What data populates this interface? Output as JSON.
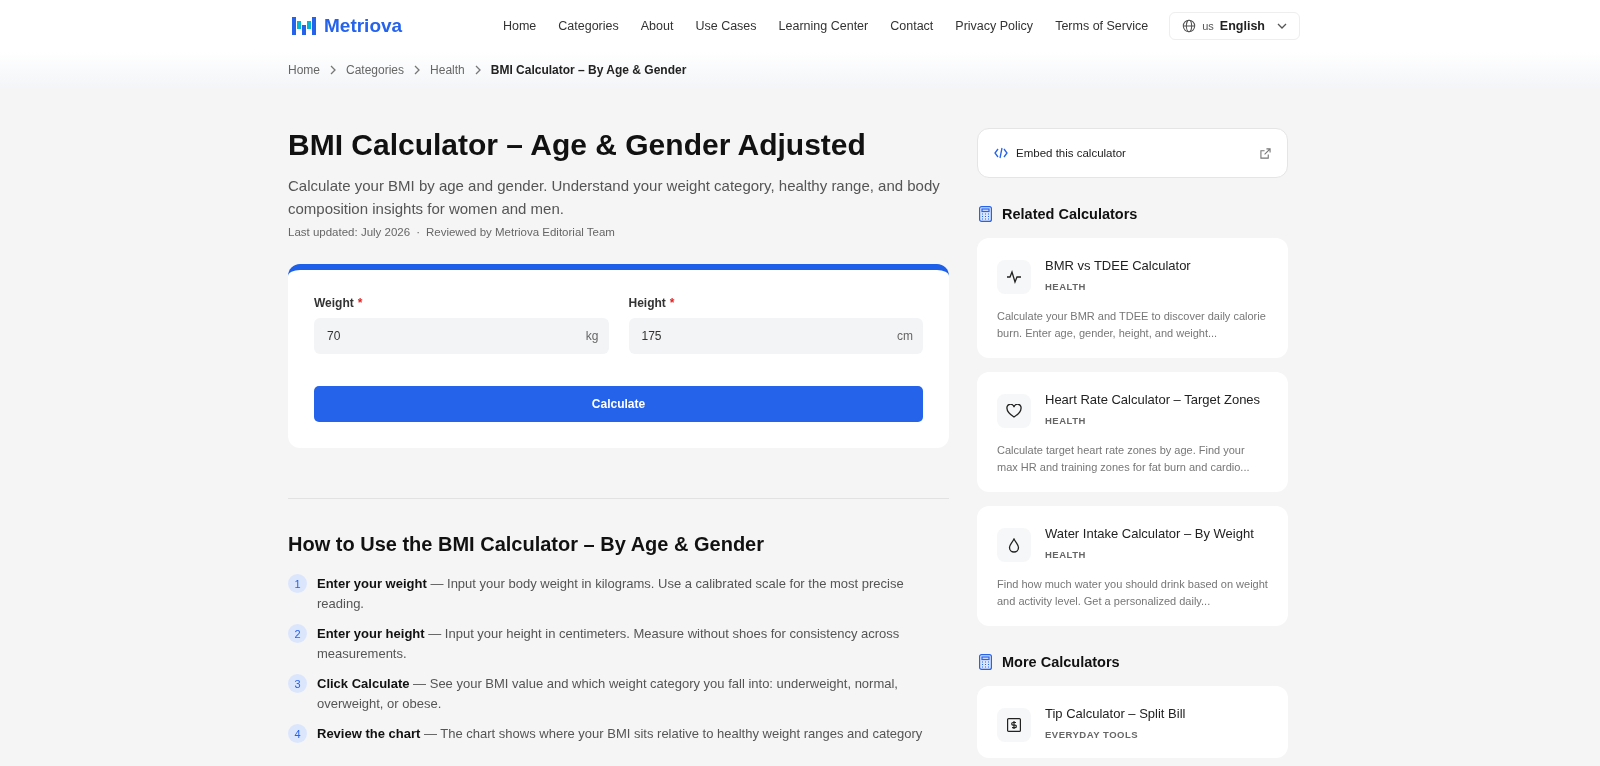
{
  "header": {
    "logo": "Metriova",
    "nav": [
      "Home",
      "Categories",
      "About",
      "Use Cases",
      "Learning Center",
      "Contact",
      "Privacy Policy",
      "Terms of Service"
    ],
    "language": {
      "code": "us",
      "label": "English"
    }
  },
  "breadcrumb": [
    "Home",
    "Categories",
    "Health",
    "BMI Calculator – By Age & Gender"
  ],
  "page": {
    "title": "BMI Calculator – Age & Gender Adjusted",
    "intro": "Calculate your BMI by age and gender. Understand your weight category, healthy range, and body composition insights for women and men.",
    "updated": "Last updated: July 2026",
    "separator": "·",
    "reviewed": "Reviewed by Metriova Editorial Team"
  },
  "form": {
    "fields": [
      {
        "label": "Weight",
        "required_mark": "*",
        "value": "70",
        "unit": "kg"
      },
      {
        "label": "Height",
        "required_mark": "*",
        "value": "175",
        "unit": "cm"
      }
    ],
    "button": "Calculate"
  },
  "how_to": {
    "title": "How to Use the BMI Calculator – By Age & Gender",
    "steps": [
      {
        "number": "1",
        "text": "**Enter your weight** — Input your body weight in kilograms. Use a calibrated scale for the most precise reading."
      },
      {
        "number": "2",
        "text": "**Enter your height** — Input your height in centimeters. Measure without shoes for consistency across measurements."
      },
      {
        "number": "3",
        "text": "**Click Calculate** — See your BMI value and which weight category you fall into: underweight, normal, overweight, or obese."
      },
      {
        "number": "4",
        "text": "**Review the chart** — The chart shows where your BMI sits relative to healthy weight ranges and category"
      }
    ]
  },
  "sidebar": {
    "embed": "Embed this calculator",
    "related": {
      "title": "Related Calculators",
      "items": [
        {
          "kind": "pulse",
          "title": "BMR vs TDEE Calculator",
          "category": "HEALTH",
          "description": "Calculate your BMR and TDEE to discover daily calorie burn. Enter age, gender, height, and weight..."
        },
        {
          "kind": "heart",
          "title": "Heart Rate Calculator – Target Zones",
          "category": "HEALTH",
          "description": "Calculate target heart rate zones by age. Find your max HR and training zones for fat burn and cardio..."
        },
        {
          "kind": "drop",
          "title": "Water Intake Calculator – By Weight",
          "category": "HEALTH",
          "description": "Find how much water you should drink based on weight and activity level. Get a personalized daily..."
        }
      ]
    },
    "more": {
      "title": "More Calculators",
      "items": [
        {
          "kind": "dollar",
          "title": "Tip Calculator – Split Bill",
          "category": "EVERYDAY TOOLS"
        }
      ]
    }
  }
}
